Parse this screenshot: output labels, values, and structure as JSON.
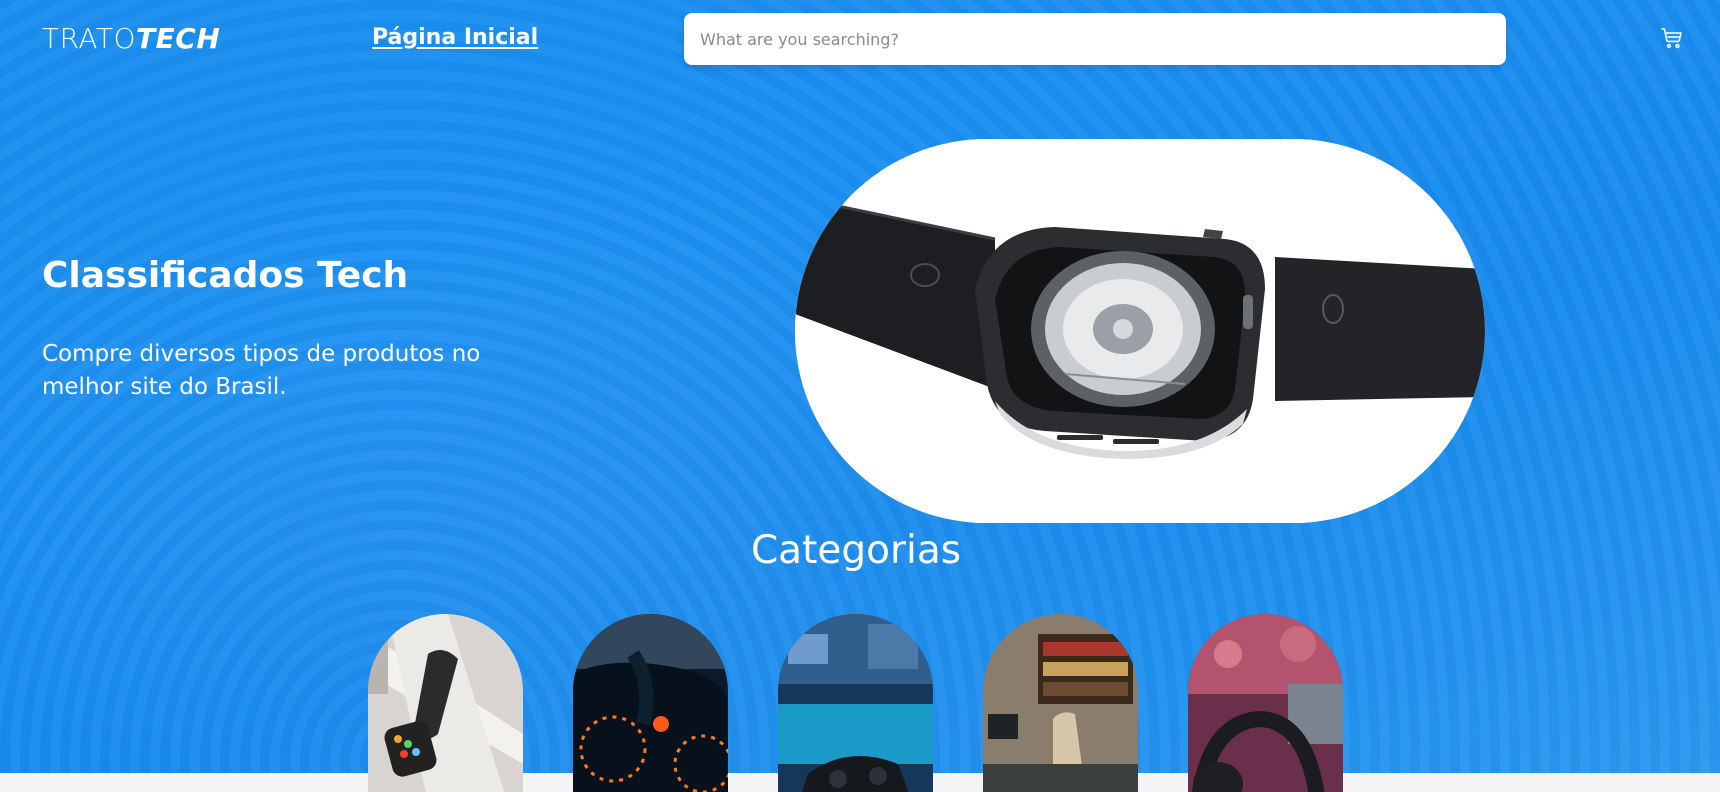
{
  "header": {
    "logo_light": "TRATO",
    "logo_bold": "TECH",
    "nav_home": "Página Inicial",
    "search_placeholder": "What are you searching?",
    "cart_icon": "cart-icon"
  },
  "hero": {
    "title": "Classificados Tech",
    "subtitle": "Compre diversos tipos de produtos no melhor site do Brasil.",
    "image": "smartwatch-back-photo"
  },
  "categories": {
    "title": "Categorias",
    "items": [
      {
        "image": "smartwatch-bands-photo"
      },
      {
        "image": "car-dashboard-photo"
      },
      {
        "image": "gaming-controller-photo"
      },
      {
        "image": "office-desk-photo"
      },
      {
        "image": "headphones-studio-photo"
      }
    ]
  },
  "colors": {
    "hero_blue": "#1a8ef0",
    "text_white": "#ffffff",
    "page_bg": "#f5f5f7"
  }
}
